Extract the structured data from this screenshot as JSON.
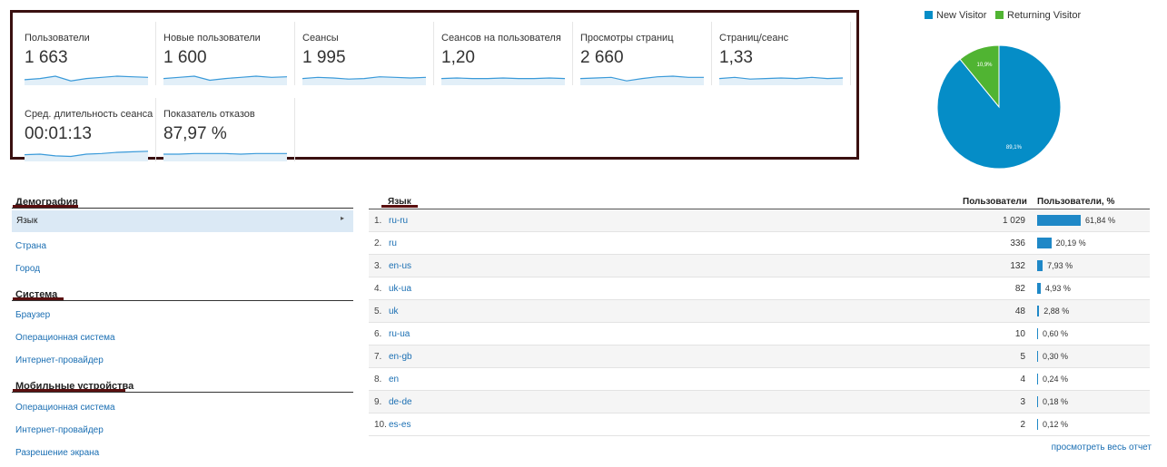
{
  "metrics": [
    {
      "label": "Пользователи",
      "value": "1 663",
      "trend": [
        0.4,
        0.5,
        0.7,
        0.3,
        0.5,
        0.6,
        0.7,
        0.65,
        0.6
      ]
    },
    {
      "label": "Новые пользователи",
      "value": "1 600",
      "trend": [
        0.5,
        0.6,
        0.7,
        0.35,
        0.5,
        0.6,
        0.7,
        0.6,
        0.65
      ]
    },
    {
      "label": "Сеансы",
      "value": "1 995",
      "trend": [
        0.5,
        0.6,
        0.55,
        0.45,
        0.5,
        0.65,
        0.6,
        0.55,
        0.6
      ]
    },
    {
      "label": "Сеансов на пользователя",
      "value": "1,20",
      "trend": [
        0.5,
        0.55,
        0.5,
        0.5,
        0.55,
        0.5,
        0.5,
        0.55,
        0.5
      ]
    },
    {
      "label": "Просмотры страниц",
      "value": "2 660",
      "trend": [
        0.5,
        0.55,
        0.6,
        0.3,
        0.5,
        0.65,
        0.7,
        0.6,
        0.6
      ]
    },
    {
      "label": "Страниц/сеанс",
      "value": "1,33",
      "trend": [
        0.5,
        0.6,
        0.45,
        0.5,
        0.55,
        0.5,
        0.6,
        0.5,
        0.55
      ]
    },
    {
      "label": "Сред. длительность сеанса",
      "value": "00:01:13",
      "trend": [
        0.5,
        0.55,
        0.4,
        0.35,
        0.55,
        0.6,
        0.7,
        0.75,
        0.8
      ]
    },
    {
      "label": "Показатель отказов",
      "value": "87,97 %",
      "trend": [
        0.55,
        0.55,
        0.6,
        0.6,
        0.6,
        0.55,
        0.6,
        0.6,
        0.6
      ]
    }
  ],
  "legend": {
    "new_label": "New Visitor",
    "returning_label": "Returning Visitor",
    "new_color": "#058dc7",
    "returning_color": "#50b432"
  },
  "chart_data": {
    "type": "pie",
    "values": [
      89.1,
      10.9
    ],
    "categories": [
      "New Visitor",
      "Returning Visitor"
    ],
    "labels": [
      "89,1%",
      "10,9%"
    ]
  },
  "nav": {
    "demography": "Демография",
    "lang": "Язык",
    "country": "Страна",
    "city": "Город",
    "system": "Система",
    "browser": "Браузер",
    "os": "Операционная система",
    "isp": "Интернет-провайдер",
    "mobile": "Мобильные устройства",
    "mobile_os": "Операционная система",
    "mobile_isp": "Интернет-провайдер",
    "resolution": "Разрешение экрана"
  },
  "table": {
    "col_lang": "Язык",
    "col_users": "Пользователи",
    "col_users_pct": "Пользователи, %",
    "rows": [
      {
        "n": "1.",
        "lang": "ru-ru",
        "users": "1 029",
        "pct": "61,84 %",
        "v": 61.84
      },
      {
        "n": "2.",
        "lang": "ru",
        "users": "336",
        "pct": "20,19 %",
        "v": 20.19
      },
      {
        "n": "3.",
        "lang": "en-us",
        "users": "132",
        "pct": "7,93 %",
        "v": 7.93
      },
      {
        "n": "4.",
        "lang": "uk-ua",
        "users": "82",
        "pct": "4,93 %",
        "v": 4.93
      },
      {
        "n": "5.",
        "lang": "uk",
        "users": "48",
        "pct": "2,88 %",
        "v": 2.88
      },
      {
        "n": "6.",
        "lang": "ru-ua",
        "users": "10",
        "pct": "0,60 %",
        "v": 0.6
      },
      {
        "n": "7.",
        "lang": "en-gb",
        "users": "5",
        "pct": "0,30 %",
        "v": 0.3
      },
      {
        "n": "8.",
        "lang": "en",
        "users": "4",
        "pct": "0,24 %",
        "v": 0.24
      },
      {
        "n": "9.",
        "lang": "de-de",
        "users": "3",
        "pct": "0,18 %",
        "v": 0.18
      },
      {
        "n": "10.",
        "lang": "es-es",
        "users": "2",
        "pct": "0,12 %",
        "v": 0.12
      }
    ],
    "view_all": "просмотреть весь отчет"
  }
}
